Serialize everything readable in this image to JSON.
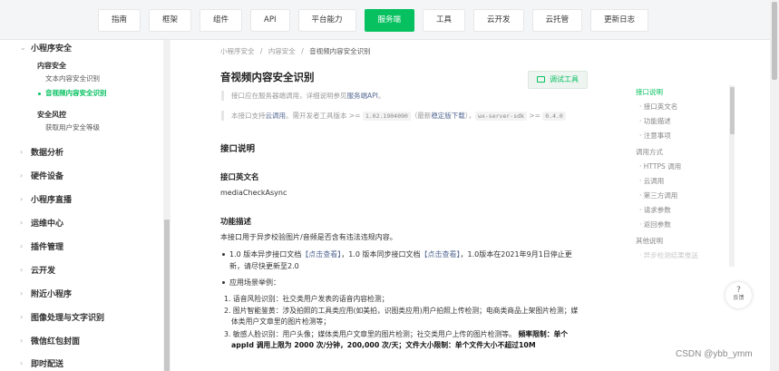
{
  "topnav": [
    "指南",
    "框架",
    "组件",
    "API",
    "平台能力",
    "服务端",
    "工具",
    "云开发",
    "云托管",
    "更新日志"
  ],
  "topnav_active_index": 5,
  "sidebar": {
    "group_top": "小程序安全",
    "sub1": "内容安全",
    "leaf1": "文本内容安全识别",
    "leaf2_active": "音视频内容安全识别",
    "sub2": "安全风控",
    "leaf3": "获取用户安全等级",
    "groups": [
      "数据分析",
      "硬件设备",
      "小程序直播",
      "运维中心",
      "插件管理",
      "云开发",
      "附近小程序",
      "图像处理与文字识别",
      "微信红包封面",
      "即时配送"
    ]
  },
  "breadcrumb": {
    "c1": "小程序安全",
    "c2": "内容安全",
    "c3": "音视频内容安全识别",
    "sep": "/"
  },
  "page": {
    "title": "音视频内容安全识别",
    "debug_button": "调试工具",
    "note1_a": "接口应在服务器端调用，详细说明参见",
    "note1_link": "服务端API",
    "note1_b": "。",
    "note2_a": "本接口支持",
    "note2_link1": "云调用",
    "note2_b": "。需开发者工具版本 >= ",
    "note2_code1": "1.02.1904090",
    "note2_c": "（最新",
    "note2_link2": "稳定版下载",
    "note2_d": "），",
    "note2_code2": "wx-server-sdk",
    "note2_e": " >= ",
    "note2_code3": "0.4.0",
    "h_interface": "接口说明",
    "h_en_name": "接口英文名",
    "en_name": "mediaCheckAsync",
    "h_func": "功能描述",
    "func_desc": "本接口用于异步校验图片/音频是否含有违法违规内容。",
    "b1_a": "1.0 版本异步接口文档",
    "b1_link1": "【点击查看】",
    "b1_b": "，1.0 版本同步接口文档",
    "b1_link2": "【点击查看】",
    "b1_c": "，1.0版本在2021年9月1日停止更",
    "b1_d": "新，请尽快更新至2.0",
    "b2": "应用场景举例：",
    "n1": "1. 语音风险识别：社交类用户发表的语音内容检测；",
    "n2a": "2. 图片智能鉴黄：涉及拍照的工具类应用(如美拍，识图类应用)用户拍照上传检测；电商类商品上架图片检测；媒",
    "n2b": "体类用户文章里的图片检测等；",
    "n3a": "3. 敏感人脸识别：用户头像；媒体类用户文章里的图片检测；社交类用户上传的图片检测等。",
    "n3_bold": " 频率限制：单个",
    "n3b": "appId 调用上限为 2000 次/分钟，200,000 次/天；文件大小限制：单个文件大小不超过10M"
  },
  "toc": [
    {
      "label": "接口说明",
      "level": 1,
      "state": "active"
    },
    {
      "label": "· 接口英文名",
      "level": 2,
      "state": "normal"
    },
    {
      "label": "· 功能描述",
      "level": 2,
      "state": "normal"
    },
    {
      "label": "· 注意事项",
      "level": 2,
      "state": "normal"
    },
    {
      "label": "调用方式",
      "level": 1,
      "state": "normal"
    },
    {
      "label": "· HTTPS 调用",
      "level": 2,
      "state": "normal"
    },
    {
      "label": "· 云调用",
      "level": 2,
      "state": "normal"
    },
    {
      "label": "· 第三方调用",
      "level": 2,
      "state": "normal"
    },
    {
      "label": "· 请求参数",
      "level": 2,
      "state": "normal"
    },
    {
      "label": "· 返回参数",
      "level": 2,
      "state": "normal"
    },
    {
      "label": "其他说明",
      "level": 1,
      "state": "normal"
    },
    {
      "label": "· 异步检测结果推送",
      "level": 2,
      "state": "faded"
    }
  ],
  "feedback": {
    "icon": "?",
    "label": "反馈"
  },
  "watermark": "CSDN @ybb_ymm",
  "colors": {
    "accent": "#07c160",
    "link": "#576b95"
  }
}
